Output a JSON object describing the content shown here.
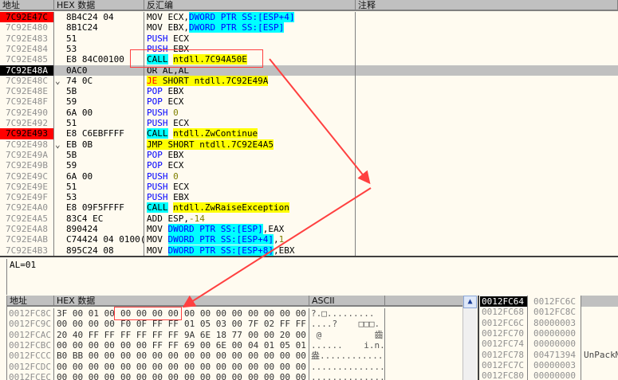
{
  "disasm": {
    "headers": {
      "addr": "地址",
      "hex": "HEX 数据",
      "code": "反汇编",
      "comment": "注释"
    },
    "rows": [
      {
        "addr": "7C92E47C",
        "state": "bp",
        "hex": "8B4C24 04",
        "jump": "",
        "code": [
          {
            "t": "MOV ECX,",
            "c": "mnem"
          },
          {
            "t": "DWORD PTR SS:[ESP+4]",
            "c": "mem"
          }
        ]
      },
      {
        "addr": "7C92E480",
        "state": "",
        "hex": "8B1C24",
        "jump": "",
        "code": [
          {
            "t": "MOV EBX,",
            "c": "mnem"
          },
          {
            "t": "DWORD PTR SS:[ESP]",
            "c": "mem"
          }
        ]
      },
      {
        "addr": "7C92E483",
        "state": "",
        "hex": "51",
        "jump": "",
        "code": [
          {
            "t": "PUSH",
            "c": "push"
          },
          {
            "t": " ECX",
            "c": "txt"
          }
        ]
      },
      {
        "addr": "7C92E484",
        "state": "",
        "hex": "53",
        "jump": "",
        "code": [
          {
            "t": "PUSH",
            "c": "push"
          },
          {
            "t": " EBX",
            "c": "txt"
          }
        ]
      },
      {
        "addr": "7C92E485",
        "state": "",
        "hex": "E8 84C00100",
        "jump": "",
        "code": [
          {
            "t": "CALL",
            "c": "call"
          },
          {
            "t": " ",
            "c": "txt"
          },
          {
            "t": "ntdll.7C94A50E",
            "c": "tgt"
          }
        ]
      },
      {
        "addr": "7C92E48A",
        "state": "eip",
        "hex": "0AC0",
        "jump": "",
        "code": [
          {
            "t": "OR AL,AL",
            "c": "mnem"
          }
        ]
      },
      {
        "addr": "7C92E48C",
        "state": "",
        "hex": "74 0C",
        "jump": "⌄",
        "code": [
          {
            "t": "JE",
            "c": "jcc"
          },
          {
            "t": " SHORT ntdll.7C92E49A",
            "c": "tgt"
          }
        ]
      },
      {
        "addr": "7C92E48E",
        "state": "",
        "hex": "5B",
        "jump": "",
        "code": [
          {
            "t": "POP",
            "c": "push"
          },
          {
            "t": " EBX",
            "c": "txt"
          }
        ]
      },
      {
        "addr": "7C92E48F",
        "state": "",
        "hex": "59",
        "jump": "",
        "code": [
          {
            "t": "POP",
            "c": "push"
          },
          {
            "t": " ECX",
            "c": "txt"
          }
        ]
      },
      {
        "addr": "7C92E490",
        "state": "",
        "hex": "6A 00",
        "jump": "",
        "code": [
          {
            "t": "PUSH",
            "c": "push"
          },
          {
            "t": " ",
            "c": "txt"
          },
          {
            "t": "0",
            "c": "num"
          }
        ]
      },
      {
        "addr": "7C92E492",
        "state": "",
        "hex": "51",
        "jump": "",
        "code": [
          {
            "t": "PUSH",
            "c": "push"
          },
          {
            "t": " ECX",
            "c": "txt"
          }
        ]
      },
      {
        "addr": "7C92E493",
        "state": "bp",
        "hex": "E8 C6EBFFFF",
        "jump": "",
        "code": [
          {
            "t": "CALL",
            "c": "call"
          },
          {
            "t": " ",
            "c": "txt"
          },
          {
            "t": "ntdll.ZwContinue",
            "c": "tgt"
          }
        ]
      },
      {
        "addr": "7C92E498",
        "state": "",
        "hex": "EB 0B",
        "jump": "⌄",
        "code": [
          {
            "t": "JMP SHORT ntdll.7C92E4A5",
            "c": "jmp"
          }
        ]
      },
      {
        "addr": "7C92E49A",
        "state": "",
        "hex": "5B",
        "jump": "",
        "code": [
          {
            "t": "POP",
            "c": "push"
          },
          {
            "t": " EBX",
            "c": "txt"
          }
        ]
      },
      {
        "addr": "7C92E49B",
        "state": "",
        "hex": "59",
        "jump": "",
        "code": [
          {
            "t": "POP",
            "c": "push"
          },
          {
            "t": " ECX",
            "c": "txt"
          }
        ]
      },
      {
        "addr": "7C92E49C",
        "state": "",
        "hex": "6A 00",
        "jump": "",
        "code": [
          {
            "t": "PUSH",
            "c": "push"
          },
          {
            "t": " ",
            "c": "txt"
          },
          {
            "t": "0",
            "c": "num"
          }
        ]
      },
      {
        "addr": "7C92E49E",
        "state": "",
        "hex": "51",
        "jump": "",
        "code": [
          {
            "t": "PUSH",
            "c": "push"
          },
          {
            "t": " ECX",
            "c": "txt"
          }
        ]
      },
      {
        "addr": "7C92E49F",
        "state": "",
        "hex": "53",
        "jump": "",
        "code": [
          {
            "t": "PUSH",
            "c": "push"
          },
          {
            "t": " EBX",
            "c": "txt"
          }
        ]
      },
      {
        "addr": "7C92E4A0",
        "state": "",
        "hex": "E8 09F5FFFF",
        "jump": "",
        "code": [
          {
            "t": "CALL",
            "c": "call"
          },
          {
            "t": " ",
            "c": "txt"
          },
          {
            "t": "ntdll.ZwRaiseException",
            "c": "tgt"
          }
        ]
      },
      {
        "addr": "7C92E4A5",
        "state": "",
        "hex": "83C4 EC",
        "jump": "",
        "code": [
          {
            "t": "ADD ESP,",
            "c": "mnem"
          },
          {
            "t": "-14",
            "c": "num"
          }
        ]
      },
      {
        "addr": "7C92E4A8",
        "state": "",
        "hex": "890424",
        "jump": "",
        "code": [
          {
            "t": "MOV ",
            "c": "mnem"
          },
          {
            "t": "DWORD PTR SS:[ESP]",
            "c": "mem"
          },
          {
            "t": ",EAX",
            "c": "txt"
          }
        ]
      },
      {
        "addr": "7C92E4AB",
        "state": "",
        "hex": "C74424 04 0100(",
        "jump": "",
        "code": [
          {
            "t": "MOV ",
            "c": "mnem"
          },
          {
            "t": "DWORD PTR SS:[ESP+4]",
            "c": "mem"
          },
          {
            "t": ",",
            "c": "txt"
          },
          {
            "t": "1",
            "c": "num"
          }
        ]
      },
      {
        "addr": "7C92E4B3",
        "state": "",
        "hex": "895C24 08",
        "jump": "",
        "code": [
          {
            "t": "MOV ",
            "c": "mnem"
          },
          {
            "t": "DWORD PTR SS:[ESP+8]",
            "c": "mem"
          },
          {
            "t": ",EBX",
            "c": "txt"
          }
        ]
      }
    ]
  },
  "info": {
    "text": "AL=01"
  },
  "dump": {
    "headers": {
      "addr": "地址",
      "hex": "HEX 数据",
      "ascii": "ASCII"
    },
    "rows": [
      {
        "addr": "0012FC8C",
        "hex": [
          "3F 00 01 00",
          "00 00 00 00",
          "00 00 00 00",
          "00 00 00 00"
        ],
        "ascii": "?.□........."
      },
      {
        "addr": "0012FC9C",
        "hex": [
          "00 00 00 00",
          "F0 0F FF FF",
          "01 05 03 00",
          "7F 02 FF FF"
        ],
        "ascii": "....?    □□□."
      },
      {
        "addr": "0012FCAC",
        "hex": [
          "20 40 FF FF",
          "FF FF FF FF",
          "9A 6E 18 77",
          "00 00 20 00"
        ],
        "ascii": " @          齒"
      },
      {
        "addr": "0012FCBC",
        "hex": [
          "00 00 00 00",
          "00 00 FF FF",
          "69 00 6E 00",
          "04 01 05 01"
        ],
        "ascii": "......    i.n.□"
      },
      {
        "addr": "0012FCCC",
        "hex": [
          "B0 BB 00 00",
          "00 00 00 00",
          "00 00 00 00",
          "00 00 00 00"
        ],
        "ascii": "盎............"
      },
      {
        "addr": "0012FCDC",
        "hex": [
          "00 00 00 00",
          "00 00 00 00",
          "00 00 00 00",
          "00 00 00 00"
        ],
        "ascii": "................"
      },
      {
        "addr": "0012FCEC",
        "hex": [
          "00 00 00 00",
          "00 00 00 00",
          "00 00 00 00",
          "00 00 00 00"
        ],
        "ascii": "................"
      }
    ]
  },
  "stack": {
    "rows": [
      {
        "addr": "0012FC64",
        "value": "0012FC6C",
        "comment": "",
        "top": true
      },
      {
        "addr": "0012FC68",
        "value": "0012FC8C",
        "comment": ""
      },
      {
        "addr": "0012FC6C",
        "value": "80000003",
        "comment": ""
      },
      {
        "addr": "0012FC70",
        "value": "00000000",
        "comment": ""
      },
      {
        "addr": "0012FC74",
        "value": "00000000",
        "comment": ""
      },
      {
        "addr": "0012FC78",
        "value": "00471394",
        "comment": "UnPackM"
      },
      {
        "addr": "0012FC7C",
        "value": "00000003",
        "comment": ""
      },
      {
        "addr": "0012FC80",
        "value": "00000000",
        "comment": ""
      }
    ]
  },
  "colors": {
    "annotation": "#ff4040",
    "breakpoint": "#ff0000",
    "background": "#fffbf0"
  },
  "icons": {
    "scroll_up": "chevron-up-icon"
  }
}
